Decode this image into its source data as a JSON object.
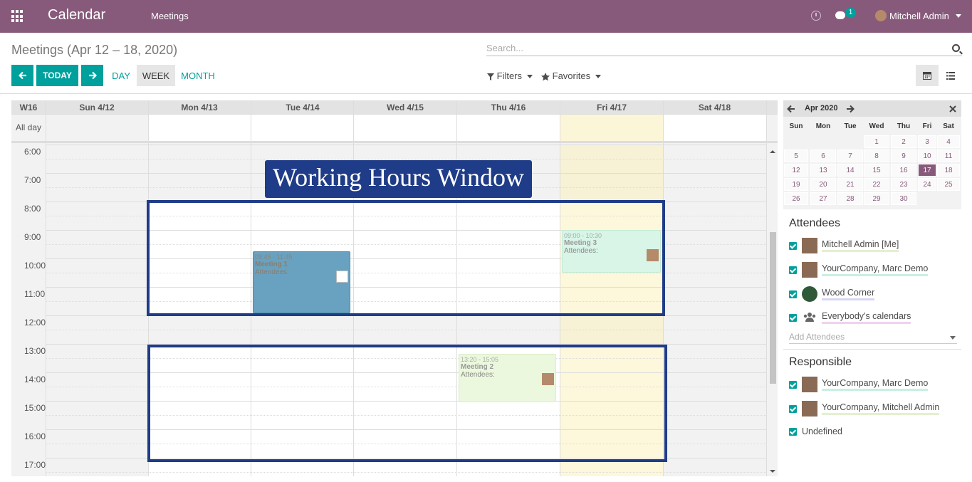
{
  "topbar": {
    "app_title": "Calendar",
    "menu_meetings": "Meetings",
    "chat_count": "1",
    "user_name": "Mitchell Admin"
  },
  "control": {
    "page_title": "Meetings (Apr 12 – 18, 2020)",
    "search_placeholder": "Search...",
    "today_label": "TODAY",
    "day_label": "DAY",
    "week_label": "WEEK",
    "month_label": "MONTH",
    "filters_label": "Filters",
    "favorites_label": "Favorites"
  },
  "grid": {
    "week_label": "W16",
    "days": [
      "Sun 4/12",
      "Mon 4/13",
      "Tue 4/14",
      "Wed 4/15",
      "Thu 4/16",
      "Fri 4/17",
      "Sat 4/18"
    ],
    "allday_label": "All day",
    "hours": [
      "6:00",
      "7:00",
      "8:00",
      "9:00",
      "10:00",
      "11:00",
      "12:00",
      "13:00",
      "14:00",
      "15:00",
      "16:00",
      "17:00"
    ]
  },
  "events": [
    {
      "time": "09:45 - 11:45",
      "title": "Meeting 1",
      "attendees": "Attendees:",
      "color": "#69a2c1"
    },
    {
      "time": "13:20 - 15:05",
      "title": "Meeting 2",
      "attendees": "Attendees:",
      "color": "#ebf8dd"
    },
    {
      "time": "09:00 - 10:30",
      "title": "Meeting 3",
      "attendees": "Attendees:",
      "color": "#d8f5e7"
    }
  ],
  "overlay_label": "Working Hours Window",
  "mini_calendar": {
    "month": "Apr 2020",
    "weekdays": [
      "Sun",
      "Mon",
      "Tue",
      "Wed",
      "Thu",
      "Fri",
      "Sat"
    ],
    "weeks": [
      [
        "",
        "",
        "",
        "1",
        "2",
        "3",
        "4"
      ],
      [
        "5",
        "6",
        "7",
        "8",
        "9",
        "10",
        "11"
      ],
      [
        "12",
        "13",
        "14",
        "15",
        "16",
        "17",
        "18"
      ],
      [
        "19",
        "20",
        "21",
        "22",
        "23",
        "24",
        "25"
      ],
      [
        "26",
        "27",
        "28",
        "29",
        "30",
        "",
        ""
      ]
    ],
    "today": "17"
  },
  "attendees": {
    "title": "Attendees",
    "items": [
      "Mitchell Admin [Me]",
      "YourCompany, Marc Demo",
      "Wood Corner",
      "Everybody's calendars"
    ],
    "add_placeholder": "Add Attendees"
  },
  "responsible": {
    "title": "Responsible",
    "items": [
      "YourCompany, Marc Demo",
      "YourCompany, Mitchell Admin",
      "Undefined"
    ]
  },
  "colors": {
    "brand": "#875a7b",
    "accent": "#00a09d",
    "overlay": "#1f3c88"
  }
}
